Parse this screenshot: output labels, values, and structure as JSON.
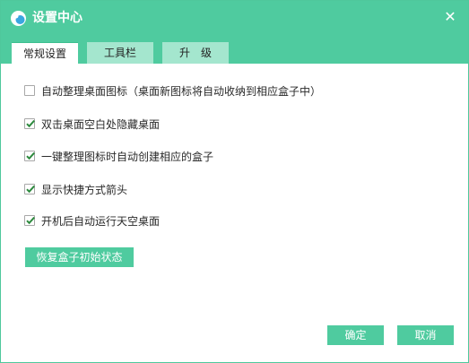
{
  "window": {
    "title": "设置中心",
    "close_glyph": "✕"
  },
  "tabs": [
    {
      "label": "常规设置",
      "active": true
    },
    {
      "label": "工具栏",
      "active": false
    },
    {
      "label": "升　级",
      "active": false
    }
  ],
  "options": [
    {
      "label": "自动整理桌面图标（桌面新图标将自动收纳到相应盒子中）",
      "checked": false
    },
    {
      "label": "双击桌面空白处隐藏桌面",
      "checked": true
    },
    {
      "label": "一键整理图标时自动创建相应的盒子",
      "checked": true
    },
    {
      "label": "显示快捷方式箭头",
      "checked": true
    },
    {
      "label": "开机后自动运行天空桌面",
      "checked": true
    }
  ],
  "buttons": {
    "restore": "恢复盒子初始状态",
    "ok": "确定",
    "cancel": "取消"
  },
  "colors": {
    "accent": "#4fcb9f",
    "tab_inactive": "#a4e6ce",
    "check": "#2d8a3e"
  },
  "icons": {
    "logo": "app-logo-icon",
    "close": "close-icon",
    "check": "checkmark-icon"
  }
}
